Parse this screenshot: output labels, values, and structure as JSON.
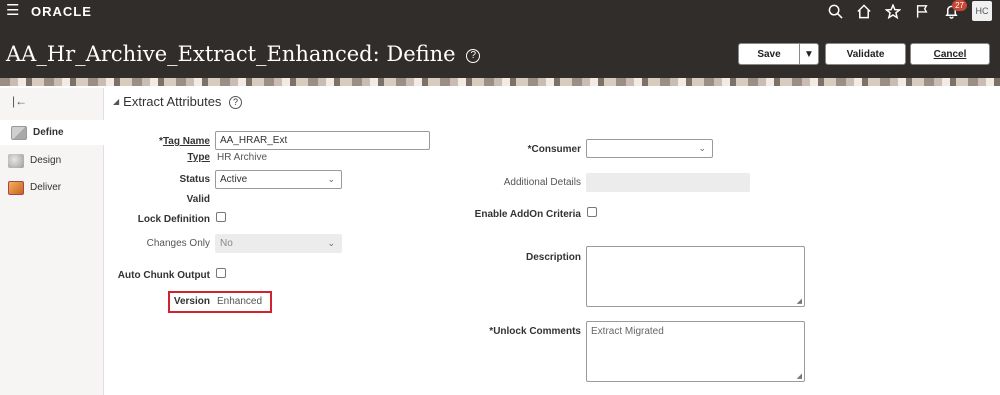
{
  "header": {
    "brand": "ORACLE",
    "notification_count": "27",
    "avatar_initials": "HC",
    "title": "AA_Hr_Archive_Extract_Enhanced: Define",
    "help_glyph": "?",
    "save_label": "Save",
    "validate_label": "Validate",
    "cancel_label": "Cancel"
  },
  "sidebar": {
    "items": [
      {
        "label": "Define",
        "icon": "define-icon",
        "active": true
      },
      {
        "label": "Design",
        "icon": "design-icon",
        "active": false
      },
      {
        "label": "Deliver",
        "icon": "deliver-icon",
        "active": false
      }
    ]
  },
  "section": {
    "title": "Extract Attributes",
    "help_glyph": "?"
  },
  "form": {
    "tag_name_label": "Tag Name",
    "tag_name_value": "AA_HRAR_Ext",
    "type_label": "Type",
    "type_value": "HR Archive",
    "status_label": "Status",
    "status_value": "Active",
    "valid_label": "Valid",
    "lock_definition_label": "Lock Definition",
    "changes_only_label": "Changes Only",
    "changes_only_value": "No",
    "auto_chunk_label": "Auto Chunk Output",
    "version_label": "Version",
    "version_value": "Enhanced",
    "consumer_label": "Consumer",
    "consumer_value": "",
    "additional_details_label": "Additional Details",
    "enable_addon_label": "Enable AddOn Criteria",
    "description_label": "Description",
    "description_value": "",
    "unlock_comments_label": "Unlock Comments",
    "unlock_comments_value": "Extract Migrated",
    "required_mark": "*"
  },
  "colors": {
    "topbar": "#312d2a",
    "highlight": "#d0232b",
    "badge": "#c74634"
  }
}
